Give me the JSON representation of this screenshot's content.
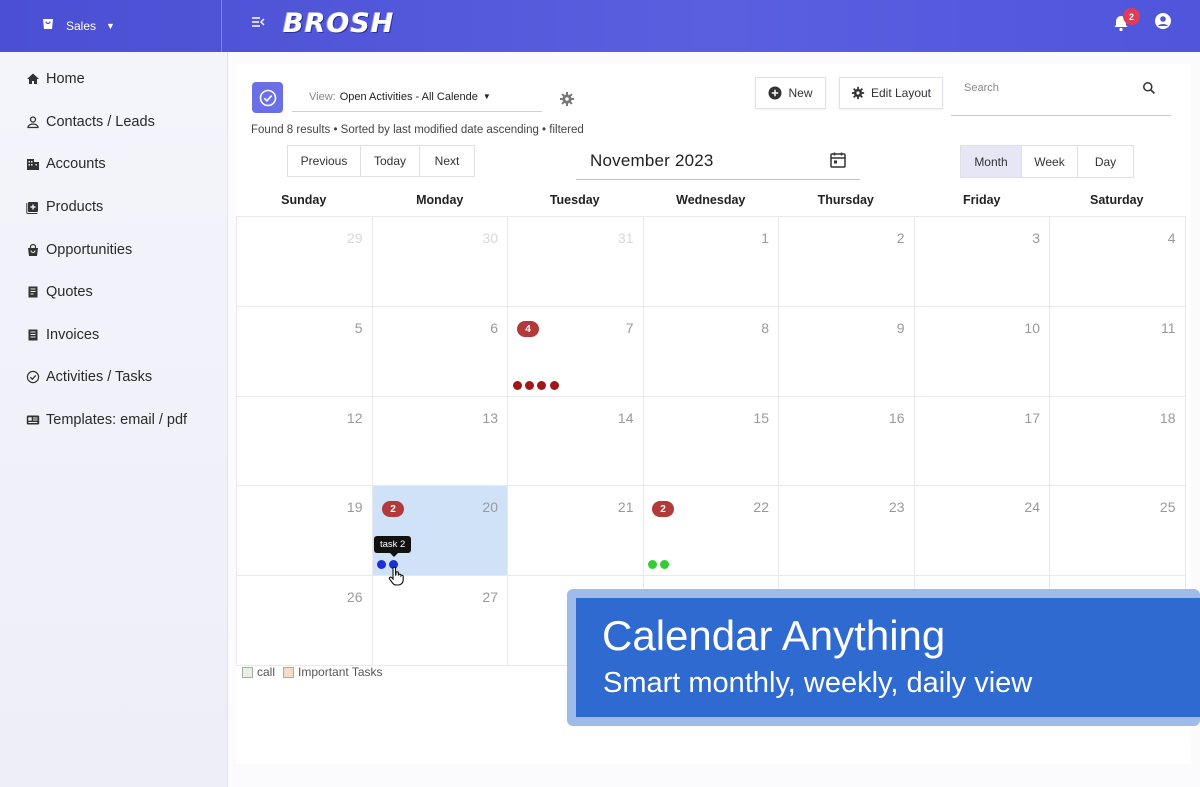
{
  "topbar": {
    "org_label": "Sales",
    "logo": "BROSH",
    "notification_count": "2",
    "icons": [
      "shopping-bag-icon",
      "menu-collapse-icon",
      "bell-icon",
      "account-circle-icon"
    ]
  },
  "sidebar": {
    "items": [
      {
        "label": "Home",
        "icon": "home-icon"
      },
      {
        "label": "Contacts / Leads",
        "icon": "person-icon"
      },
      {
        "label": "Accounts",
        "icon": "building-icon"
      },
      {
        "label": "Products",
        "icon": "product-box-icon"
      },
      {
        "label": "Opportunities",
        "icon": "bag-icon"
      },
      {
        "label": "Quotes",
        "icon": "document-icon"
      },
      {
        "label": "Invoices",
        "icon": "invoice-icon"
      },
      {
        "label": "Activities / Tasks",
        "icon": "check-circle-icon"
      },
      {
        "label": "Templates: email / pdf",
        "icon": "template-card-icon"
      }
    ]
  },
  "toolbar": {
    "view_prefix": "View:",
    "view_value": "Open Activities - All Calende",
    "results_text": "Found 8 results • Sorted by last modified date ascending • filtered",
    "new_label": "New",
    "edit_layout_label": "Edit Layout",
    "search_placeholder": "Search"
  },
  "calendar_nav": {
    "previous": "Previous",
    "today": "Today",
    "next": "Next",
    "title": "November 2023",
    "modes": [
      "Month",
      "Week",
      "Day"
    ],
    "active_mode": "Month"
  },
  "calendar": {
    "days_of_week": [
      "Sunday",
      "Monday",
      "Tuesday",
      "Wednesday",
      "Thursday",
      "Friday",
      "Saturday"
    ],
    "weeks": [
      [
        "29",
        "30",
        "31",
        "1",
        "2",
        "3",
        "4"
      ],
      [
        "5",
        "6",
        "7",
        "8",
        "9",
        "10",
        "11"
      ],
      [
        "12",
        "13",
        "14",
        "15",
        "16",
        "17",
        "18"
      ],
      [
        "19",
        "20",
        "21",
        "22",
        "23",
        "24",
        "25"
      ],
      [
        "26",
        "27",
        "",
        "",
        "",
        "",
        ""
      ]
    ],
    "faded_dates": [
      "29",
      "30",
      "31"
    ],
    "selected_date": "20",
    "badges": [
      {
        "date": "7",
        "count": "4"
      },
      {
        "date": "20",
        "count": "2"
      },
      {
        "date": "22",
        "count": "2"
      }
    ],
    "event_dot_colors": {
      "7": "#a01818",
      "20": "#1a2fd6",
      "22": "#33cc33"
    },
    "tooltip": "task 2"
  },
  "legend": [
    {
      "label": "call",
      "color": "#e7f1df"
    },
    {
      "label": "Important Tasks",
      "color": "#f3dcc8"
    }
  ],
  "banner": {
    "title": "Calendar Anything",
    "subtitle": "Smart monthly, weekly, daily view"
  }
}
